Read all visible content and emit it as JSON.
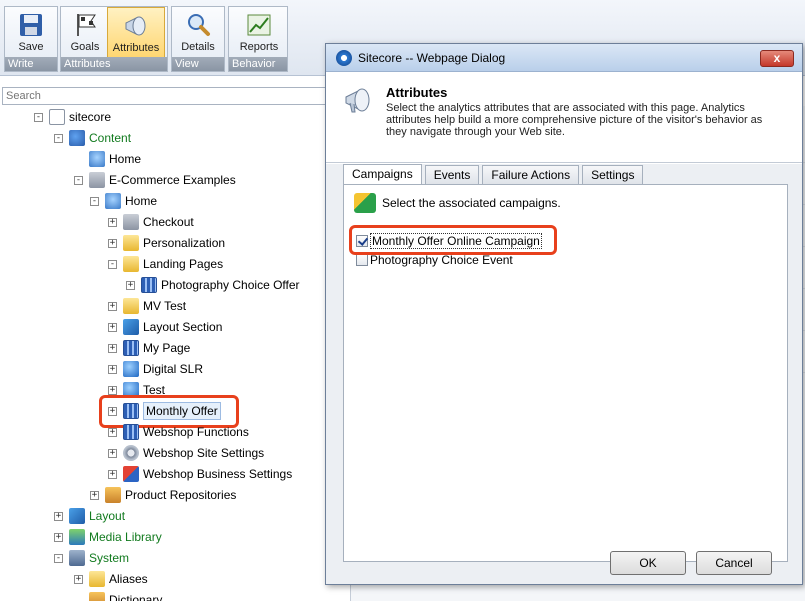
{
  "ribbon": {
    "buttons": [
      {
        "label": "Save",
        "icon": "floppy-disk-icon"
      },
      {
        "label": "Goals",
        "icon": "flag-icon"
      },
      {
        "label": "Attributes",
        "icon": "megaphone-icon"
      },
      {
        "label": "Details",
        "icon": "magnifier-icon"
      },
      {
        "label": "Reports",
        "icon": "chart-icon"
      }
    ],
    "groups": [
      "Write",
      "Attributes",
      "View",
      "Behavior"
    ]
  },
  "search": {
    "placeholder": "Search"
  },
  "tree": [
    {
      "label": "sitecore",
      "toggle": "-"
    },
    {
      "label": "Content",
      "toggle": "-"
    },
    {
      "label": "Home",
      "toggle": ""
    },
    {
      "label": "E-Commerce Examples",
      "toggle": "-"
    },
    {
      "label": "Home",
      "toggle": "-"
    },
    {
      "label": "Checkout",
      "toggle": "+"
    },
    {
      "label": "Personalization",
      "toggle": "+"
    },
    {
      "label": "Landing Pages",
      "toggle": "-"
    },
    {
      "label": "Photography Choice Offer",
      "toggle": "+"
    },
    {
      "label": "MV Test",
      "toggle": "+"
    },
    {
      "label": "Layout Section",
      "toggle": "+"
    },
    {
      "label": "My Page",
      "toggle": "+"
    },
    {
      "label": "Digital SLR",
      "toggle": "+"
    },
    {
      "label": "Test",
      "toggle": "+"
    },
    {
      "label": "Monthly Offer",
      "toggle": "+"
    },
    {
      "label": "Webshop Functions",
      "toggle": "+"
    },
    {
      "label": "Webshop Site Settings",
      "toggle": "+"
    },
    {
      "label": "Webshop Business Settings",
      "toggle": "+"
    },
    {
      "label": "Product Repositories",
      "toggle": "+"
    },
    {
      "label": "Layout",
      "toggle": "+"
    },
    {
      "label": "Media Library",
      "toggle": "+"
    },
    {
      "label": "System",
      "toggle": "-"
    },
    {
      "label": "Aliases",
      "toggle": "+"
    },
    {
      "label": "Dictionary",
      "toggle": ""
    }
  ],
  "dialog": {
    "title": "Sitecore -- Webpage Dialog",
    "close": "x",
    "heading": "Attributes",
    "description": "Select the analytics attributes that are associated with this page. Analytics attributes help build a more comprehensive picture of the visitor's behavior as they navigate through your Web site.",
    "tabs": [
      "Campaigns",
      "Events",
      "Failure Actions",
      "Settings"
    ],
    "instruction": "Select the associated campaigns.",
    "campaigns": [
      {
        "label": "Monthly Offer Online Campaign",
        "checked": true
      },
      {
        "label": "Photography Choice Event",
        "checked": false
      }
    ],
    "ok": "OK",
    "cancel": "Cancel"
  },
  "colors": {
    "highlight": "#e8401c",
    "tree_green": "#117a1e"
  }
}
